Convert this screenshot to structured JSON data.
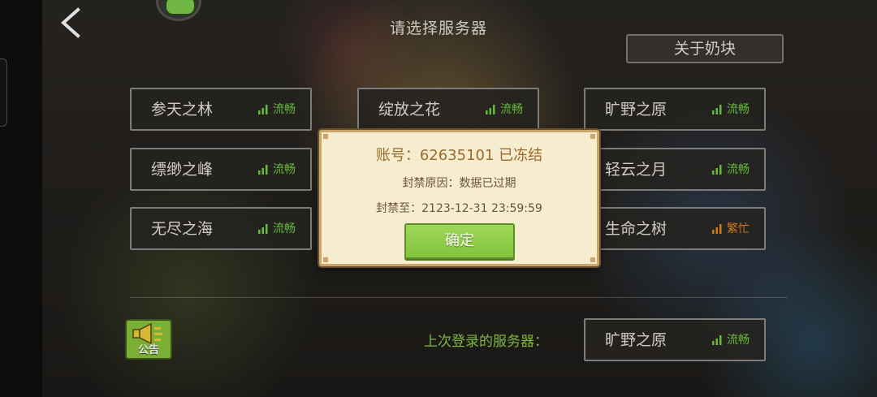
{
  "header": {
    "title": "请选择服务器",
    "about_label": "关于奶块"
  },
  "servers": [
    {
      "name": "参天之林",
      "status": "流畅",
      "status_color": "#72d442"
    },
    {
      "name": "绽放之花",
      "status": "流畅",
      "status_color": "#72d442"
    },
    {
      "name": "旷野之原",
      "status": "流畅",
      "status_color": "#72d442"
    },
    {
      "name": "缥缈之峰",
      "status": "流畅",
      "status_color": "#72d442"
    },
    {
      "name": "轻云之月",
      "status": "流畅",
      "status_color": "#72d442"
    },
    {
      "name": "无尽之海",
      "status": "流畅",
      "status_color": "#72d442"
    },
    {
      "name": "生命之树",
      "status": "繁忙",
      "status_color": "#ee8a1e"
    }
  ],
  "bottom": {
    "notice_label": "公告",
    "last_server_label": "上次登录的服务器：",
    "last_server": {
      "name": "旷野之原",
      "status": "流畅",
      "status_color": "#72d442"
    }
  },
  "dialog": {
    "account_line": "账号：62635101 已冻结",
    "reason_line": "封禁原因：数据已过期",
    "until_line": "封禁至：2123-12-31 23:59:59",
    "confirm_label": "确定"
  },
  "icons": {
    "back": "chevron-left-icon",
    "signal": "signal-bars-icon",
    "notice": "megaphone-icon"
  }
}
